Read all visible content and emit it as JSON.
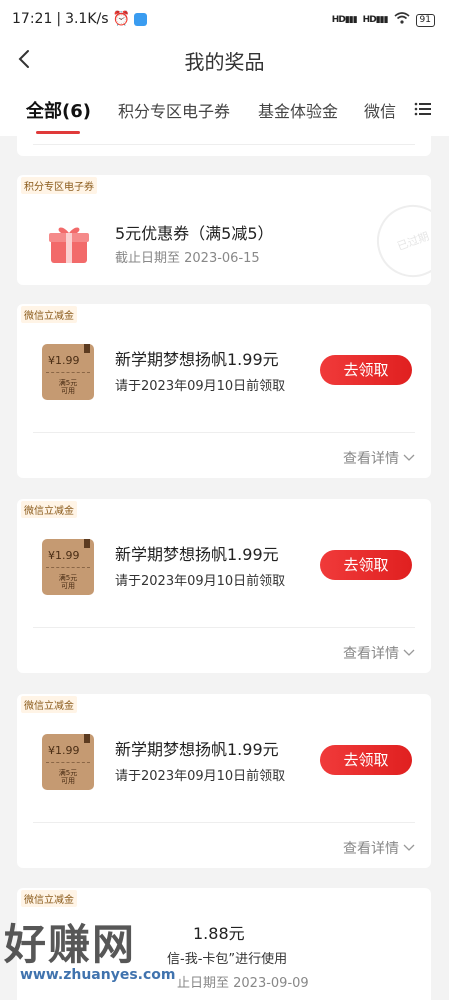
{
  "status_bar": {
    "time": "17:21",
    "speed": "3.1K/s",
    "battery": "91",
    "signal1": "HD",
    "signal2": "HD"
  },
  "header": {
    "title": "我的奖品"
  },
  "tabs": [
    {
      "label": "全部(6)"
    },
    {
      "label": "积分专区电子券"
    },
    {
      "label": "基金体验金"
    },
    {
      "label": "微信"
    }
  ],
  "cards": [
    {
      "category": "积分专区电子券",
      "title": "5元优惠券（满5减5）",
      "subtitle": "截止日期至 2023-06-15",
      "stamp": "已过期"
    },
    {
      "category": "微信立减金",
      "coupon_amount": "¥1.99",
      "coupon_cond": "满5元\n可用",
      "title": "新学期梦想扬帆1.99元",
      "subtitle": "请于2023年09月10日前领取",
      "button": "去领取",
      "details": "查看详情"
    },
    {
      "category": "微信立减金",
      "coupon_amount": "¥1.99",
      "coupon_cond": "满5元\n可用",
      "title": "新学期梦想扬帆1.99元",
      "subtitle": "请于2023年09月10日前领取",
      "button": "去领取",
      "details": "查看详情"
    },
    {
      "category": "微信立减金",
      "coupon_amount": "¥1.99",
      "coupon_cond": "满5元\n可用",
      "title": "新学期梦想扬帆1.99元",
      "subtitle": "请于2023年09月10日前领取",
      "button": "去领取",
      "details": "查看详情"
    },
    {
      "category": "微信立减金",
      "title": "1.88元",
      "subtitle1": "信-我-卡包”进行使用",
      "subtitle2": "止日期至 2023-09-09"
    }
  ],
  "watermark": {
    "text": "好赚网",
    "url": "www.zhuanyes.com"
  }
}
